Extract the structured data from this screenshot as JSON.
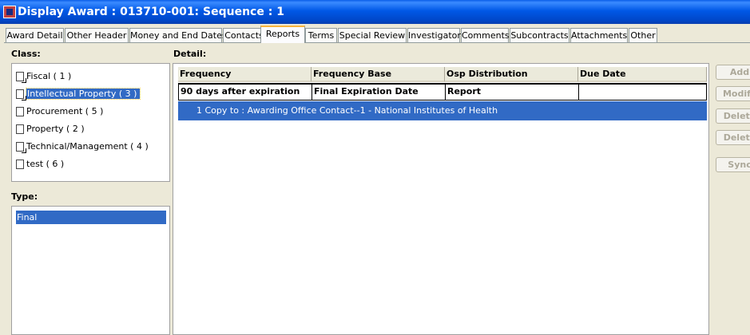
{
  "window": {
    "title": "Display Award : 013710-001: Sequence : 1"
  },
  "tabs": [
    {
      "label": "Award Detail"
    },
    {
      "label": "Other Header"
    },
    {
      "label": "Money and End Dates"
    },
    {
      "label": "Contacts"
    },
    {
      "label": "Reports",
      "active": true
    },
    {
      "label": "Terms"
    },
    {
      "label": "Special Review"
    },
    {
      "label": "Investigator"
    },
    {
      "label": "Comments"
    },
    {
      "label": "Subcontracts"
    },
    {
      "label": "Attachments"
    },
    {
      "label": "Other"
    }
  ],
  "class_section": {
    "label": "Class:",
    "items": [
      {
        "label": "Fiscal ( 1 )",
        "icon": "document-marked-icon"
      },
      {
        "label": "Intellectual Property ( 3 )",
        "icon": "document-marked-icon",
        "selected": true
      },
      {
        "label": "Procurement ( 5 )",
        "icon": "document-icon"
      },
      {
        "label": "Property ( 2 )",
        "icon": "document-icon"
      },
      {
        "label": "Technical/Management ( 4 )",
        "icon": "document-marked-icon"
      },
      {
        "label": "test ( 6 )",
        "icon": "document-icon"
      }
    ]
  },
  "type_section": {
    "label": "Type:",
    "items": [
      {
        "label": "Final",
        "selected": true
      }
    ]
  },
  "detail": {
    "label": "Detail:",
    "columns": [
      "Frequency",
      "Frequency Base",
      "Osp Distribution",
      "Due Date"
    ],
    "rows": [
      {
        "cells": [
          "90 days after expiration",
          "Final Expiration Date",
          "Report",
          ""
        ]
      }
    ],
    "distribution_row": "1 Copy to : Awarding Office Contact--1 - National Institutes of Health"
  },
  "side_buttons": [
    {
      "label": "Add"
    },
    {
      "label": "Modify"
    },
    {
      "label": "Delete"
    },
    {
      "label": "Delete All"
    },
    {
      "label": "Sync"
    }
  ],
  "colors": {
    "selection": "#316ac5",
    "title_bar": "#0058e6",
    "background": "#ece9d8",
    "active_tab_accent": "#f8b43c"
  }
}
